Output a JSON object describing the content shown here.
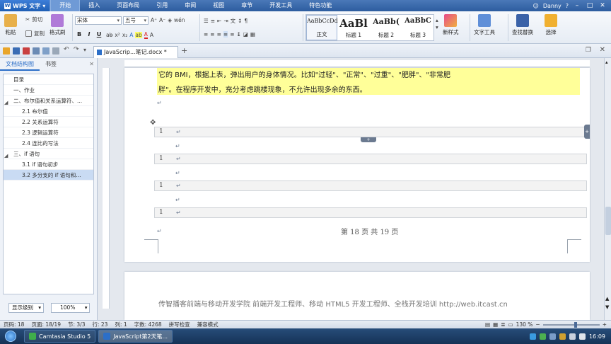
{
  "app": {
    "name": "WPS 文字",
    "menu": [
      "开始",
      "插入",
      "页面布局",
      "引用",
      "审阅",
      "视图",
      "章节",
      "开发工具",
      "特色功能"
    ],
    "active_menu": "开始",
    "user": "Danny"
  },
  "ribbon": {
    "paste": "粘贴",
    "cut": "剪切",
    "copy": "复制",
    "format_painter": "格式刷",
    "font_name": "宋体",
    "font_size": "五号",
    "styles": [
      {
        "sample": "AaBbCcDd",
        "label": "正文"
      },
      {
        "sample": "AaBl",
        "label": "标题 1"
      },
      {
        "sample": "AaBb(",
        "label": "标题 2"
      },
      {
        "sample": "AaBbC",
        "label": "标题 3"
      }
    ],
    "new_style": "新样式",
    "text_tools": "文字工具",
    "find_replace": "查找替换",
    "select": "选择"
  },
  "document_tab": {
    "name": "JavaScrip...笔记.docx *"
  },
  "left_pane": {
    "tabs": [
      "文档结构图",
      "书签"
    ],
    "active_tab": "文档结构图",
    "outline": [
      {
        "label": "目录",
        "level": 0,
        "selected": false
      },
      {
        "label": "一、作业",
        "level": 1,
        "selected": false
      },
      {
        "label": "二、布尔值和关系运算符、...",
        "level": 1,
        "selected": false
      },
      {
        "label": "2.1 布尔值",
        "level": 2,
        "selected": false
      },
      {
        "label": "2.2 关系运算符",
        "level": 2,
        "selected": false
      },
      {
        "label": "2.3 逻辑运算符",
        "level": 2,
        "selected": false
      },
      {
        "label": "2.4 连比的写法",
        "level": 2,
        "selected": false
      },
      {
        "label": "三、if 语句",
        "level": 1,
        "selected": false
      },
      {
        "label": "3.1 if 语句初步",
        "level": 2,
        "selected": false
      },
      {
        "label": "3.2 多分支的 if 语句和...",
        "level": 2,
        "selected": true
      }
    ],
    "display_level": "显示级别",
    "zoom": "100%"
  },
  "document": {
    "line1": "它的 BMI，根据上表，弹出用户的身体情况。比如\"过轻\"、\"正常\"、\"过重\"、\"肥胖\"、\"非常肥",
    "line2": "胖\"。在程序开发中，充分考虑跳楼现象，不允许出现多余的东西。",
    "code_rows": [
      "1",
      "1",
      "1",
      "1"
    ],
    "page_footer": "第 18 页 共 19 页",
    "next_header": "传智播客前端与移动开发学院        前端开发工程师、移动 HTML5 开发工程师、全栈开发培训        http://web.itcast.cn"
  },
  "status": {
    "page": "页码: 18",
    "pages": "页面: 18/19",
    "section": "节: 3/3",
    "line": "行: 23",
    "column": "列: 1",
    "words": "字数: 4268",
    "spell": "拼写检查",
    "compat": "兼容模式",
    "zoom": "130 %"
  },
  "taskbar": {
    "items": [
      "Camtasia Studio 5",
      "JavaScript第2天笔..."
    ],
    "time": "16:09"
  },
  "colors": {
    "accent": "#2c6fc8",
    "highlight": "#ffff99",
    "title_bar": "#2d5d9f"
  }
}
